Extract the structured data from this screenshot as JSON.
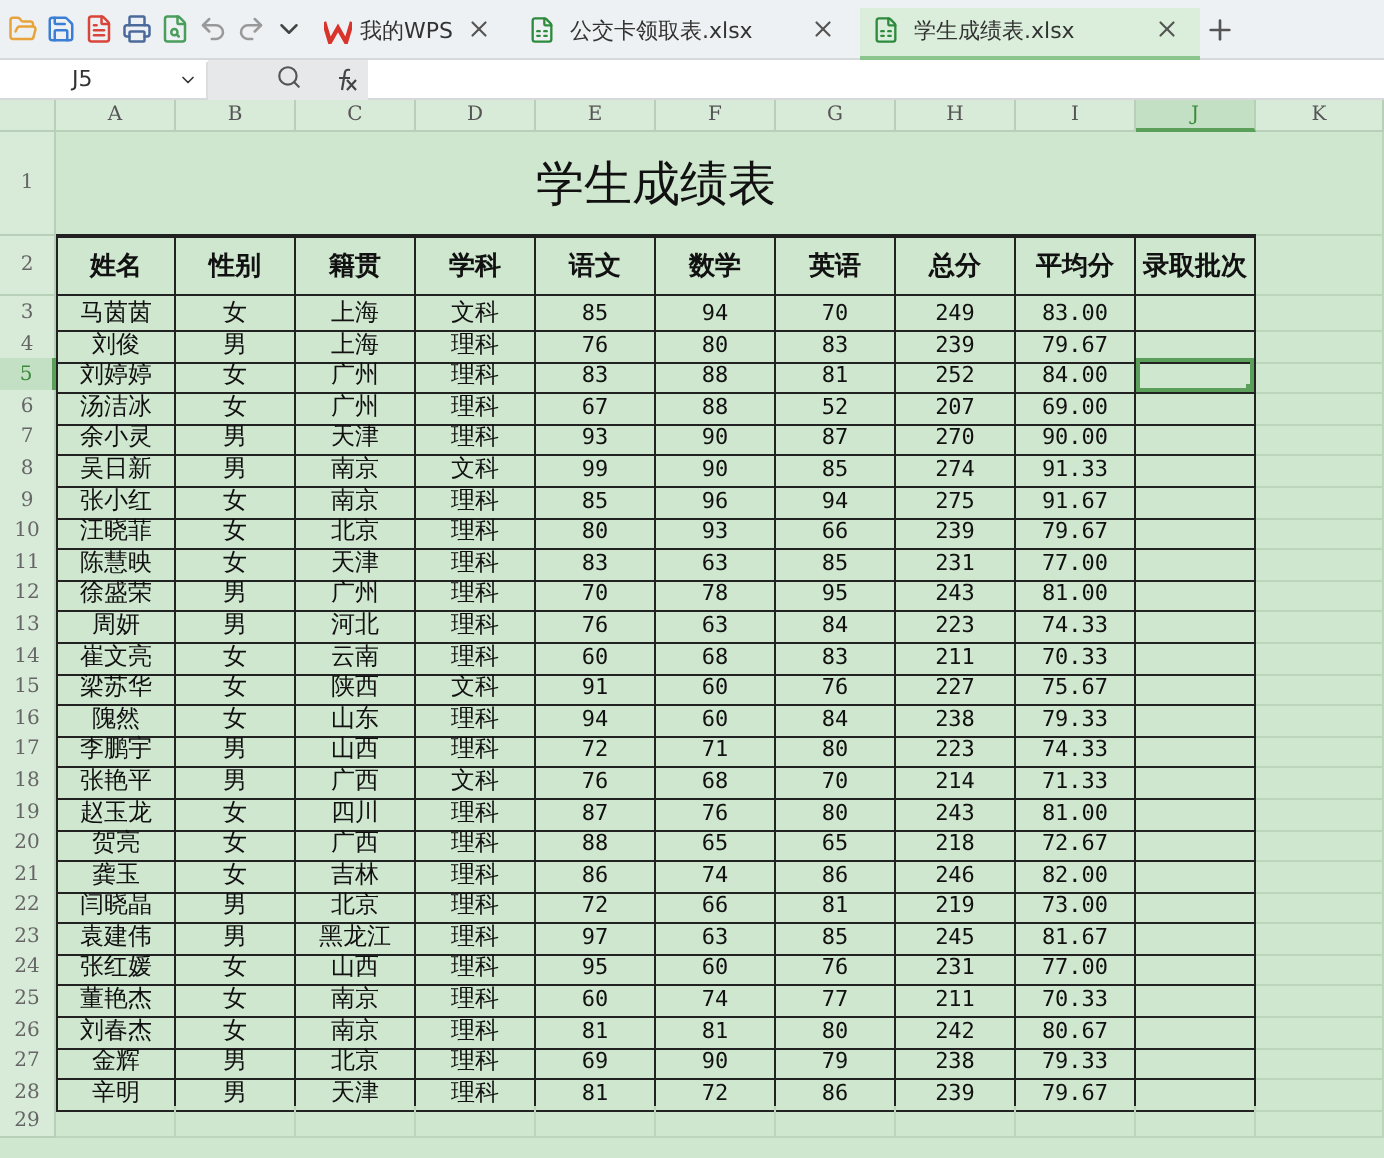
{
  "toolbar": {
    "tabs": [
      {
        "kind": "home",
        "label": "我的WPS",
        "selected": false
      },
      {
        "kind": "sheet",
        "label": "公交卡领取表.xlsx",
        "selected": false
      },
      {
        "kind": "sheet",
        "label": "学生成绩表.xlsx",
        "selected": true
      }
    ]
  },
  "formula_bar": {
    "cell_ref": "J5"
  },
  "columns": [
    {
      "label": "A",
      "selected": false
    },
    {
      "label": "B",
      "selected": false
    },
    {
      "label": "C",
      "selected": false
    },
    {
      "label": "D",
      "selected": false
    },
    {
      "label": "E",
      "selected": false
    },
    {
      "label": "F",
      "selected": false
    },
    {
      "label": "G",
      "selected": false
    },
    {
      "label": "H",
      "selected": false
    },
    {
      "label": "I",
      "selected": false
    },
    {
      "label": "J",
      "selected": true
    },
    {
      "label": "K",
      "selected": false
    }
  ],
  "title_row": {
    "number": "1",
    "title": "学生成绩表"
  },
  "header_row": {
    "number": "2",
    "cells": [
      "姓名",
      "性别",
      "籍贯",
      "学科",
      "语文",
      "数学",
      "英语",
      "总分",
      "平均分",
      "录取批次"
    ]
  },
  "data_rows": [
    {
      "number": "3",
      "selected": false,
      "cells": [
        "马茵茵",
        "女",
        "上海",
        "文科",
        "85",
        "94",
        "70",
        "249",
        "83.00"
      ]
    },
    {
      "number": "4",
      "selected": false,
      "cells": [
        "刘俊",
        "男",
        "上海",
        "理科",
        "76",
        "80",
        "83",
        "239",
        "79.67"
      ]
    },
    {
      "number": "5",
      "selected": true,
      "cells": [
        "刘婷婷",
        "女",
        "广州",
        "理科",
        "83",
        "88",
        "81",
        "252",
        "84.00"
      ]
    },
    {
      "number": "6",
      "selected": false,
      "cells": [
        "汤洁冰",
        "女",
        "广州",
        "理科",
        "67",
        "88",
        "52",
        "207",
        "69.00"
      ]
    },
    {
      "number": "7",
      "selected": false,
      "cells": [
        "余小灵",
        "男",
        "天津",
        "理科",
        "93",
        "90",
        "87",
        "270",
        "90.00"
      ]
    },
    {
      "number": "8",
      "selected": false,
      "cells": [
        "吴日新",
        "男",
        "南京",
        "文科",
        "99",
        "90",
        "85",
        "274",
        "91.33"
      ]
    },
    {
      "number": "9",
      "selected": false,
      "cells": [
        "张小红",
        "女",
        "南京",
        "理科",
        "85",
        "96",
        "94",
        "275",
        "91.67"
      ]
    },
    {
      "number": "10",
      "selected": false,
      "cells": [
        "汪晓菲",
        "女",
        "北京",
        "理科",
        "80",
        "93",
        "66",
        "239",
        "79.67"
      ]
    },
    {
      "number": "11",
      "selected": false,
      "cells": [
        "陈慧映",
        "女",
        "天津",
        "理科",
        "83",
        "63",
        "85",
        "231",
        "77.00"
      ]
    },
    {
      "number": "12",
      "selected": false,
      "cells": [
        "徐盛荣",
        "男",
        "广州",
        "理科",
        "70",
        "78",
        "95",
        "243",
        "81.00"
      ]
    },
    {
      "number": "13",
      "selected": false,
      "cells": [
        "周妍",
        "男",
        "河北",
        "理科",
        "76",
        "63",
        "84",
        "223",
        "74.33"
      ]
    },
    {
      "number": "14",
      "selected": false,
      "cells": [
        "崔文亮",
        "女",
        "云南",
        "理科",
        "60",
        "68",
        "83",
        "211",
        "70.33"
      ]
    },
    {
      "number": "15",
      "selected": false,
      "cells": [
        "梁苏华",
        "女",
        "陕西",
        "文科",
        "91",
        "60",
        "76",
        "227",
        "75.67"
      ]
    },
    {
      "number": "16",
      "selected": false,
      "cells": [
        "隗然",
        "女",
        "山东",
        "理科",
        "94",
        "60",
        "84",
        "238",
        "79.33"
      ]
    },
    {
      "number": "17",
      "selected": false,
      "cells": [
        "李鹏宇",
        "男",
        "山西",
        "理科",
        "72",
        "71",
        "80",
        "223",
        "74.33"
      ]
    },
    {
      "number": "18",
      "selected": false,
      "cells": [
        "张艳平",
        "男",
        "广西",
        "文科",
        "76",
        "68",
        "70",
        "214",
        "71.33"
      ]
    },
    {
      "number": "19",
      "selected": false,
      "cells": [
        "赵玉龙",
        "女",
        "四川",
        "理科",
        "87",
        "76",
        "80",
        "243",
        "81.00"
      ]
    },
    {
      "number": "20",
      "selected": false,
      "cells": [
        "贺亮",
        "女",
        "广西",
        "理科",
        "88",
        "65",
        "65",
        "218",
        "72.67"
      ]
    },
    {
      "number": "21",
      "selected": false,
      "cells": [
        "龚玉",
        "女",
        "吉林",
        "理科",
        "86",
        "74",
        "86",
        "246",
        "82.00"
      ]
    },
    {
      "number": "22",
      "selected": false,
      "cells": [
        "闫晓晶",
        "男",
        "北京",
        "理科",
        "72",
        "66",
        "81",
        "219",
        "73.00"
      ]
    },
    {
      "number": "23",
      "selected": false,
      "cells": [
        "袁建伟",
        "男",
        "黑龙江",
        "理科",
        "97",
        "63",
        "85",
        "245",
        "81.67"
      ]
    },
    {
      "number": "24",
      "selected": false,
      "cells": [
        "张红媛",
        "女",
        "山西",
        "理科",
        "95",
        "60",
        "76",
        "231",
        "77.00"
      ]
    },
    {
      "number": "25",
      "selected": false,
      "cells": [
        "董艳杰",
        "女",
        "南京",
        "理科",
        "60",
        "74",
        "77",
        "211",
        "70.33"
      ]
    },
    {
      "number": "26",
      "selected": false,
      "cells": [
        "刘春杰",
        "女",
        "南京",
        "理科",
        "81",
        "81",
        "80",
        "242",
        "80.67"
      ]
    },
    {
      "number": "27",
      "selected": false,
      "cells": [
        "金辉",
        "男",
        "北京",
        "理科",
        "69",
        "90",
        "79",
        "238",
        "79.33"
      ]
    },
    {
      "number": "28",
      "selected": false,
      "cells": [
        "辛明",
        "男",
        "天津",
        "理科",
        "81",
        "72",
        "86",
        "239",
        "79.67"
      ]
    }
  ],
  "empty_rows": [
    {
      "number": "29"
    }
  ]
}
